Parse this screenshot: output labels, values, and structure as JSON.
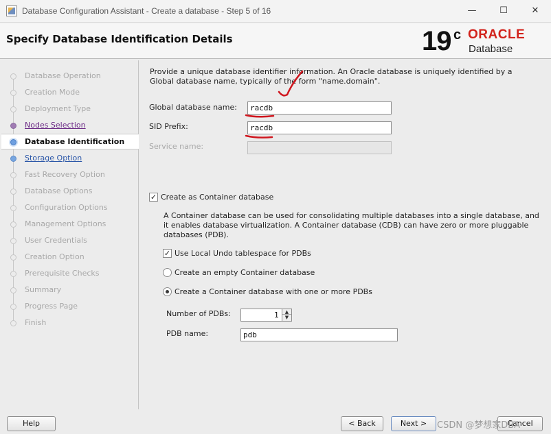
{
  "window": {
    "title": "Database Configuration Assistant - Create a database - Step 5 of 16",
    "minimize_glyph": "—",
    "maximize_glyph": "☐",
    "close_glyph": "✕"
  },
  "header": {
    "title": "Specify Database Identification Details",
    "logo": {
      "version": "19",
      "version_suffix": "c",
      "brand": "ORACLE",
      "product": "Database"
    }
  },
  "nav": {
    "items": [
      {
        "label": "Database Operation",
        "state": "disabled"
      },
      {
        "label": "Creation Mode",
        "state": "disabled"
      },
      {
        "label": "Deployment Type",
        "state": "disabled"
      },
      {
        "label": "Nodes Selection",
        "state": "done"
      },
      {
        "label": "Database Identification",
        "state": "active"
      },
      {
        "label": "Storage Option",
        "state": "link"
      },
      {
        "label": "Fast Recovery Option",
        "state": "disabled"
      },
      {
        "label": "Database Options",
        "state": "disabled"
      },
      {
        "label": "Configuration Options",
        "state": "disabled"
      },
      {
        "label": "Management Options",
        "state": "disabled"
      },
      {
        "label": "User Credentials",
        "state": "disabled"
      },
      {
        "label": "Creation Option",
        "state": "disabled"
      },
      {
        "label": "Prerequisite Checks",
        "state": "disabled"
      },
      {
        "label": "Summary",
        "state": "disabled"
      },
      {
        "label": "Progress Page",
        "state": "disabled"
      },
      {
        "label": "Finish",
        "state": "disabled"
      }
    ]
  },
  "content": {
    "intro": "Provide a unique database identifier information. An Oracle database is uniquely identified by a Global database name, typically of the form \"name.domain\".",
    "global_db_name": {
      "label": "Global database name:",
      "value": "racdb"
    },
    "sid_prefix": {
      "label": "SID Prefix:",
      "value": "racdb"
    },
    "service_name": {
      "label": "Service name:",
      "value": ""
    },
    "container": {
      "label": "Create as Container database",
      "checked": true,
      "description": "A Container database can be used for consolidating multiple databases into a single database, and it enables database virtualization. A Container database (CDB) can have zero or more pluggable databases (PDB).",
      "local_undo": {
        "label": "Use Local Undo tablespace for PDBs",
        "checked": true
      },
      "empty_cdb": {
        "label": "Create an empty Container database",
        "selected": false
      },
      "with_pdbs": {
        "label": "Create a Container database with one or more PDBs",
        "selected": true
      },
      "num_pdbs": {
        "label": "Number of PDBs:",
        "value": "1"
      },
      "pdb_name": {
        "label": "PDB name:",
        "value": "pdb"
      }
    }
  },
  "footer": {
    "help": "Help",
    "back": "< Back",
    "next": "Next >",
    "cancel": "Cancel",
    "watermark": "CSDN @梦想家DBA"
  },
  "colors": {
    "annotation_red": "#d0161e",
    "oracle_red": "#d2231c",
    "nav_link": "#2a56a8",
    "nav_visited": "#6c2b86"
  }
}
